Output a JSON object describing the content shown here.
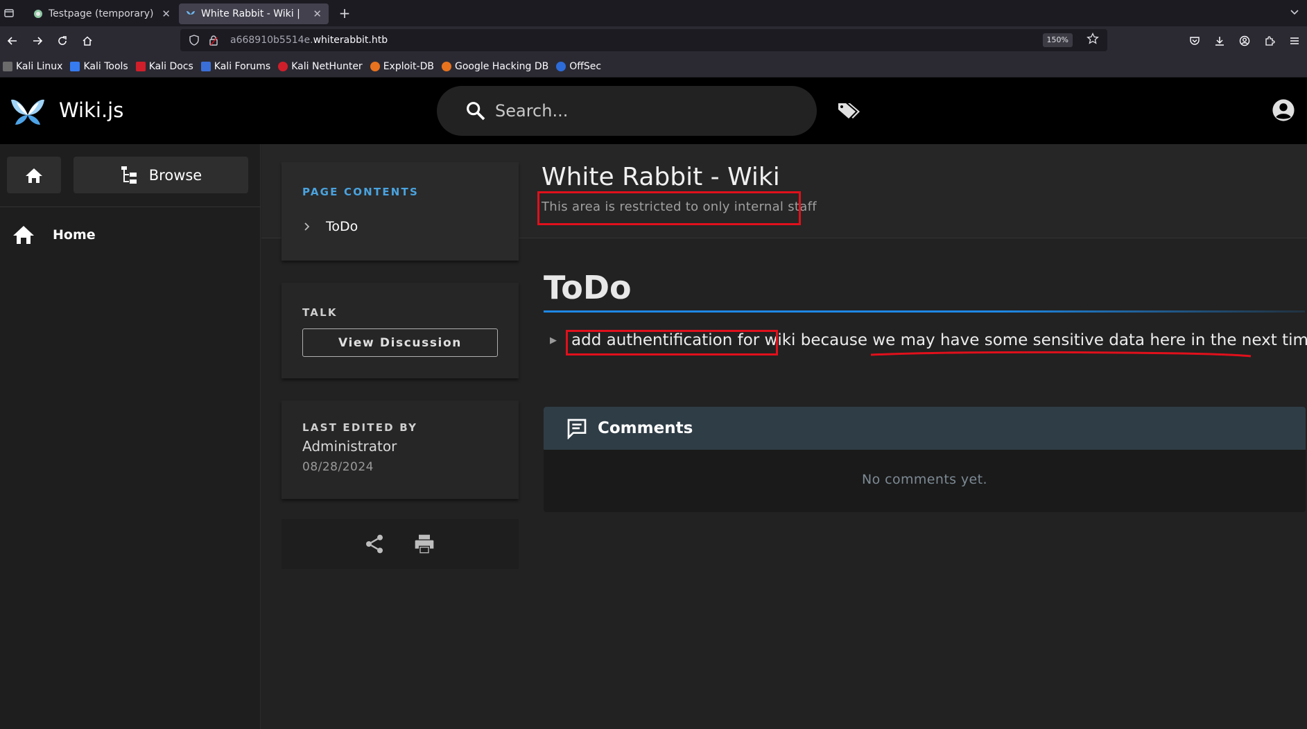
{
  "browser": {
    "tabs": [
      {
        "title": "Testpage (temporary)",
        "active": false
      },
      {
        "title": "White Rabbit - Wiki | Wik",
        "active": true
      }
    ],
    "url_prefix": "a668910b5514e.",
    "url_domain": "whiterabbit.htb",
    "zoom": "150%",
    "bookmarks": [
      {
        "label": "Kali Linux",
        "color": "#6b6b6b"
      },
      {
        "label": "Kali Tools",
        "color": "#367bf0"
      },
      {
        "label": "Kali Docs",
        "color": "#d01f2a"
      },
      {
        "label": "Kali Forums",
        "color": "#3b6fd8"
      },
      {
        "label": "Kali NetHunter",
        "color": "#d01f2a"
      },
      {
        "label": "Exploit-DB",
        "color": "#e8731e"
      },
      {
        "label": "Google Hacking DB",
        "color": "#e8731e"
      },
      {
        "label": "OffSec",
        "color": "#2d6bd8"
      }
    ]
  },
  "app": {
    "brand": "Wiki.js",
    "search_placeholder": "Search..."
  },
  "sidebar": {
    "browse_label": "Browse",
    "home_label": "Home"
  },
  "page": {
    "title": "White Rabbit - Wiki",
    "subtitle": "This area is restricted to only internal staff"
  },
  "toc": {
    "label": "PAGE CONTENTS",
    "items": [
      "ToDo"
    ]
  },
  "talk": {
    "label": "TALK",
    "button": "View Discussion"
  },
  "last_edited": {
    "label": "LAST EDITED BY",
    "user": "Administrator",
    "date": "08/28/2024"
  },
  "content": {
    "heading": "ToDo",
    "item_highlight": "add authentification for wiki",
    "item_middle": " because we ",
    "item_tail": "may have some sensitive data here in the next time"
  },
  "comments": {
    "title": "Comments",
    "empty": "No comments yet."
  },
  "colors": {
    "annotation_red": "#e0101b",
    "accent_blue": "#1e88e5",
    "toc_label": "#4aa3df"
  }
}
